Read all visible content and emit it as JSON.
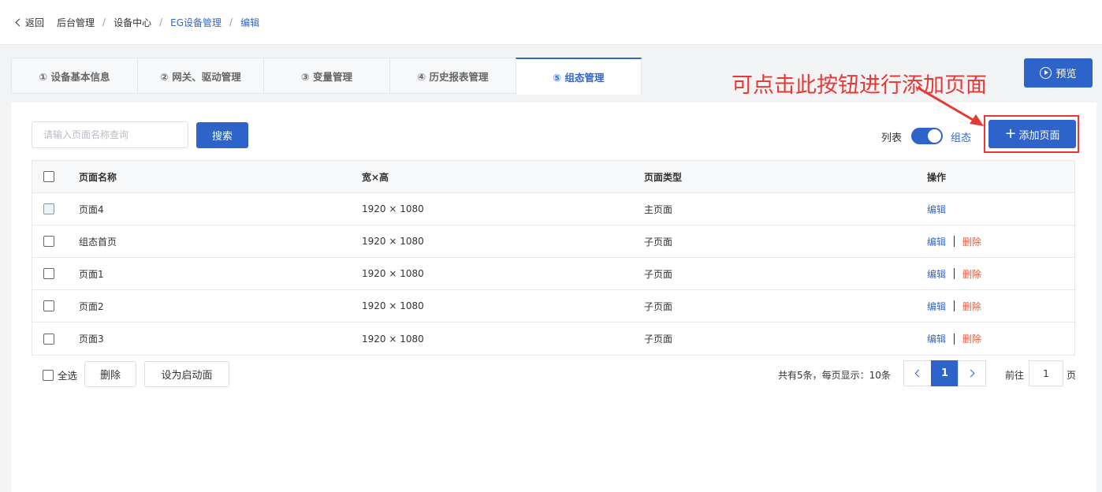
{
  "header": {
    "back_label": "返回",
    "breadcrumb": [
      "后台管理",
      "设备中心",
      "EG设备管理",
      "编辑"
    ],
    "separator": "/"
  },
  "tabs": [
    {
      "label": "① 设备基本信息",
      "active": false
    },
    {
      "label": "② 网关、驱动管理",
      "active": false
    },
    {
      "label": "③ 变量管理",
      "active": false
    },
    {
      "label": "④ 历史报表管理",
      "active": false
    },
    {
      "label": "⑤ 组态管理",
      "active": true
    }
  ],
  "toolbar": {
    "preview_label": "预览",
    "search_placeholder": "请输入页面名称查询",
    "search_label": "搜索",
    "view_left_label": "列表",
    "view_right_label": "组态",
    "add_page_label": "添加页面"
  },
  "annotation": {
    "text": "可点击此按钮进行添加页面",
    "color": "#e53935"
  },
  "table": {
    "columns": [
      "页面名称",
      "宽×高",
      "页面类型",
      "操作"
    ],
    "rows": [
      {
        "name": "页面4",
        "size": "1920 × 1080",
        "type": "主页面",
        "edit": "编辑",
        "delete": ""
      },
      {
        "name": "组态首页",
        "size": "1920 × 1080",
        "type": "子页面",
        "edit": "编辑",
        "delete": "删除"
      },
      {
        "name": "页面1",
        "size": "1920 × 1080",
        "type": "子页面",
        "edit": "编辑",
        "delete": "删除"
      },
      {
        "name": "页面2",
        "size": "1920 × 1080",
        "type": "子页面",
        "edit": "编辑",
        "delete": "删除"
      },
      {
        "name": "页面3",
        "size": "1920 × 1080",
        "type": "子页面",
        "edit": "编辑",
        "delete": "删除"
      }
    ]
  },
  "footer": {
    "select_all_label": "全选",
    "delete_label": "删除",
    "set_startup_label": "设为启动面",
    "total_prefix": "共有5条，每页显示：",
    "per_page": "10条",
    "current_page": "1",
    "goto_prefix": "前往",
    "goto_value": "1",
    "goto_suffix": "页"
  },
  "colors": {
    "primary": "#2e63c9",
    "link": "#3366cc",
    "danger": "#e55a3c"
  }
}
